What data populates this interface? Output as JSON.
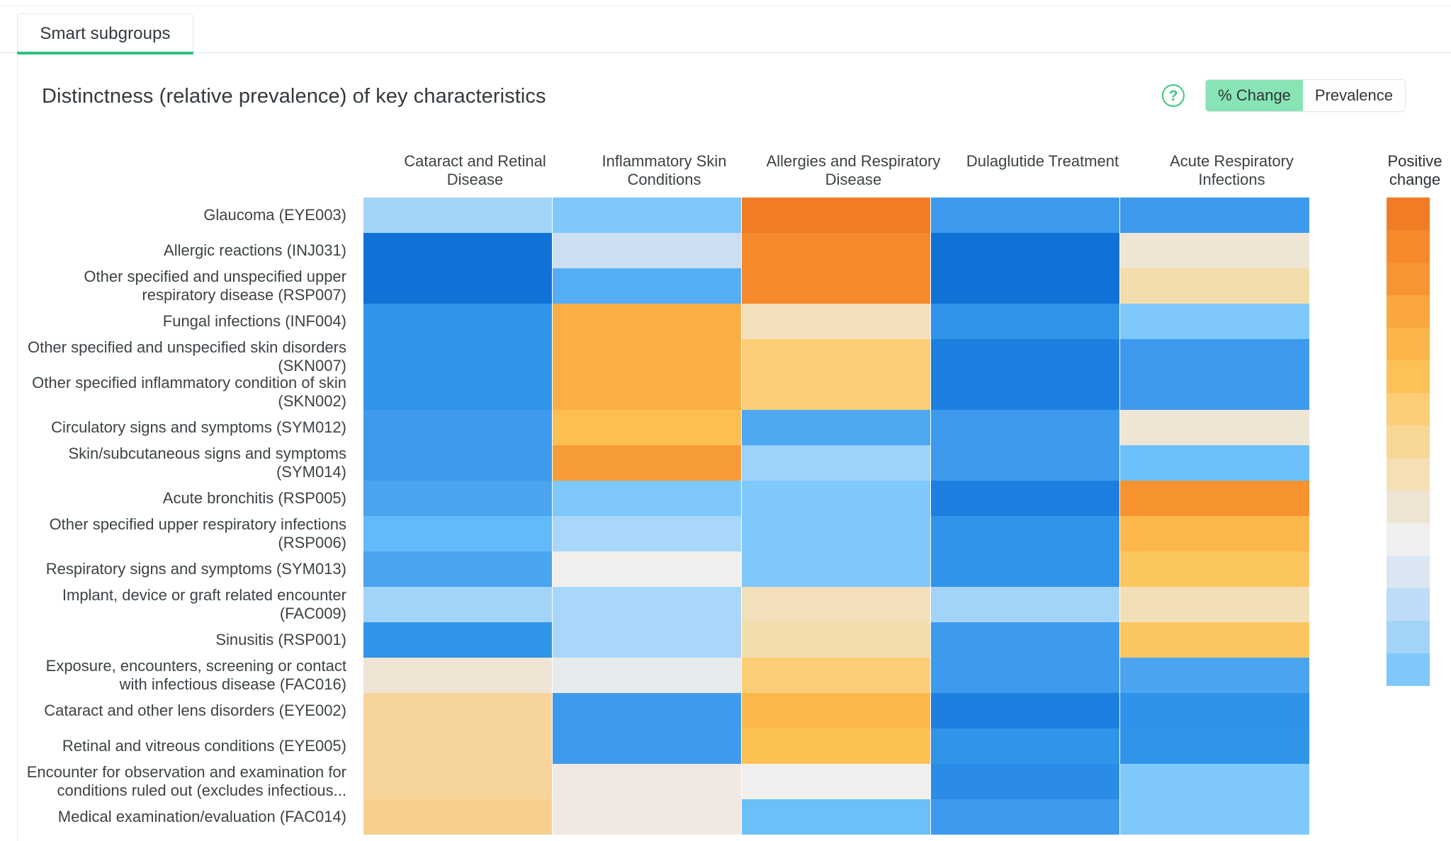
{
  "tab": {
    "label": "Smart subgroups"
  },
  "header": {
    "title": "Distinctness (relative prevalence) of key characteristics",
    "help_icon": "question-circle-icon",
    "toggle": {
      "options": [
        "% Change",
        "Prevalence"
      ],
      "selected": "% Change"
    }
  },
  "legend": {
    "title_line1": "Positive",
    "title_line2": "change",
    "swatches": [
      "#f07d26",
      "#f6892b",
      "#f79433",
      "#fba73f",
      "#fcb44b",
      "#fdc156",
      "#fbcd76",
      "#f8d693",
      "#f4e0b4",
      "#ede4d4",
      "#f0efed",
      "#dae6f1",
      "#bcdcf7",
      "#a3d4f8",
      "#7ec8fb"
    ]
  },
  "chart_data": {
    "type": "heatmap",
    "title": "Distinctness (relative prevalence) of key characteristics",
    "xlabel": "",
    "ylabel": "",
    "legend_title": "Positive change",
    "metric": "% Change",
    "columns": [
      "Cataract and Retinal Disease",
      "Inflammatory Skin Conditions",
      "Allergies and Respiratory Disease",
      "Dulaglutide Treatment",
      "Acute Respiratory Infections"
    ],
    "rows": [
      "Glaucoma (EYE003)",
      "Allergic reactions (INJ031)",
      "Other specified and unspecified upper respiratory disease (RSP007)",
      "Fungal infections (INF004)",
      "Other specified and unspecified skin disorders (SKN007)",
      "Other specified inflammatory condition of skin (SKN002)",
      "Circulatory signs and symptoms (SYM012)",
      "Skin/subcutaneous signs and symptoms (SYM014)",
      "Acute bronchitis (RSP005)",
      "Other specified upper respiratory infections (RSP006)",
      "Respiratory signs and symptoms (SYM013)",
      "Implant, device or graft related encounter (FAC009)",
      "Sinusitis (RSP001)",
      "Exposure, encounters, screening or contact with infectious disease (FAC016)",
      "Cataract and other lens disorders (EYE002)",
      "Retinal and vitreous conditions (EYE005)",
      "Encounter for observation and examination for conditions ruled out (excludes infectious...",
      "Medical examination/evaluation (FAC014)"
    ],
    "cell_colors": [
      [
        "#a3d4f8",
        "#7ec8fb",
        "#f07d26",
        "#3d9aec",
        "#3d9aec"
      ],
      [
        "#1072d6",
        "#cbdef2",
        "#f6892b",
        "#1072d6",
        "#efe5d5"
      ],
      [
        "#1072d6",
        "#55aef4",
        "#f6892b",
        "#1072d6",
        "#f2ddad"
      ],
      [
        "#3094e9",
        "#fbad46",
        "#f2dfbc",
        "#3094e9",
        "#7ec8fb"
      ],
      [
        "#3094e9",
        "#fbad46",
        "#fbcd76",
        "#1d80e0",
        "#3d9aec"
      ],
      [
        "#3094e9",
        "#fbad46",
        "#fbcd76",
        "#1d80e0",
        "#3d9aec"
      ],
      [
        "#3d9aec",
        "#fdbe52",
        "#4da8f2",
        "#3d9aec",
        "#efe5d5"
      ],
      [
        "#3d9aec",
        "#f79b37",
        "#9dd2f9",
        "#3d9aec",
        "#6cc0fa"
      ],
      [
        "#4aa4f0",
        "#7ec8fb",
        "#7ec8fb",
        "#1d80e0",
        "#f6932f"
      ],
      [
        "#63baf8",
        "#a8d7f9",
        "#7ec8fb",
        "#3094e9",
        "#fcb84c"
      ],
      [
        "#4aa4f0",
        "#f0efed",
        "#7ec8fb",
        "#3094e9",
        "#fcc65f"
      ],
      [
        "#a3d4f8",
        "#a8d7f9",
        "#f2dfbc",
        "#a3d4f8",
        "#f3dfb7"
      ],
      [
        "#3094e9",
        "#a8d7f9",
        "#f2ddad",
        "#3d9aec",
        "#fbc65f"
      ],
      [
        "#efe5d5",
        "#e5eaec",
        "#fbcd76",
        "#3d9aec",
        "#4aa4f0"
      ],
      [
        "#f7d49a",
        "#3d9aec",
        "#fcb84c",
        "#1d80e0",
        "#2e93e9"
      ],
      [
        "#f7d49a",
        "#3d9aec",
        "#fcc053",
        "#3094e9",
        "#3094e9"
      ],
      [
        "#f7d49a",
        "#efe9e1",
        "#f0efed",
        "#2a8ce6",
        "#7ec8fb"
      ],
      [
        "#f8d08e",
        "#efe9e1",
        "#6cc0fa",
        "#3d9aec",
        "#7ec8fb"
      ]
    ],
    "grid": false,
    "legend_position": "right"
  }
}
